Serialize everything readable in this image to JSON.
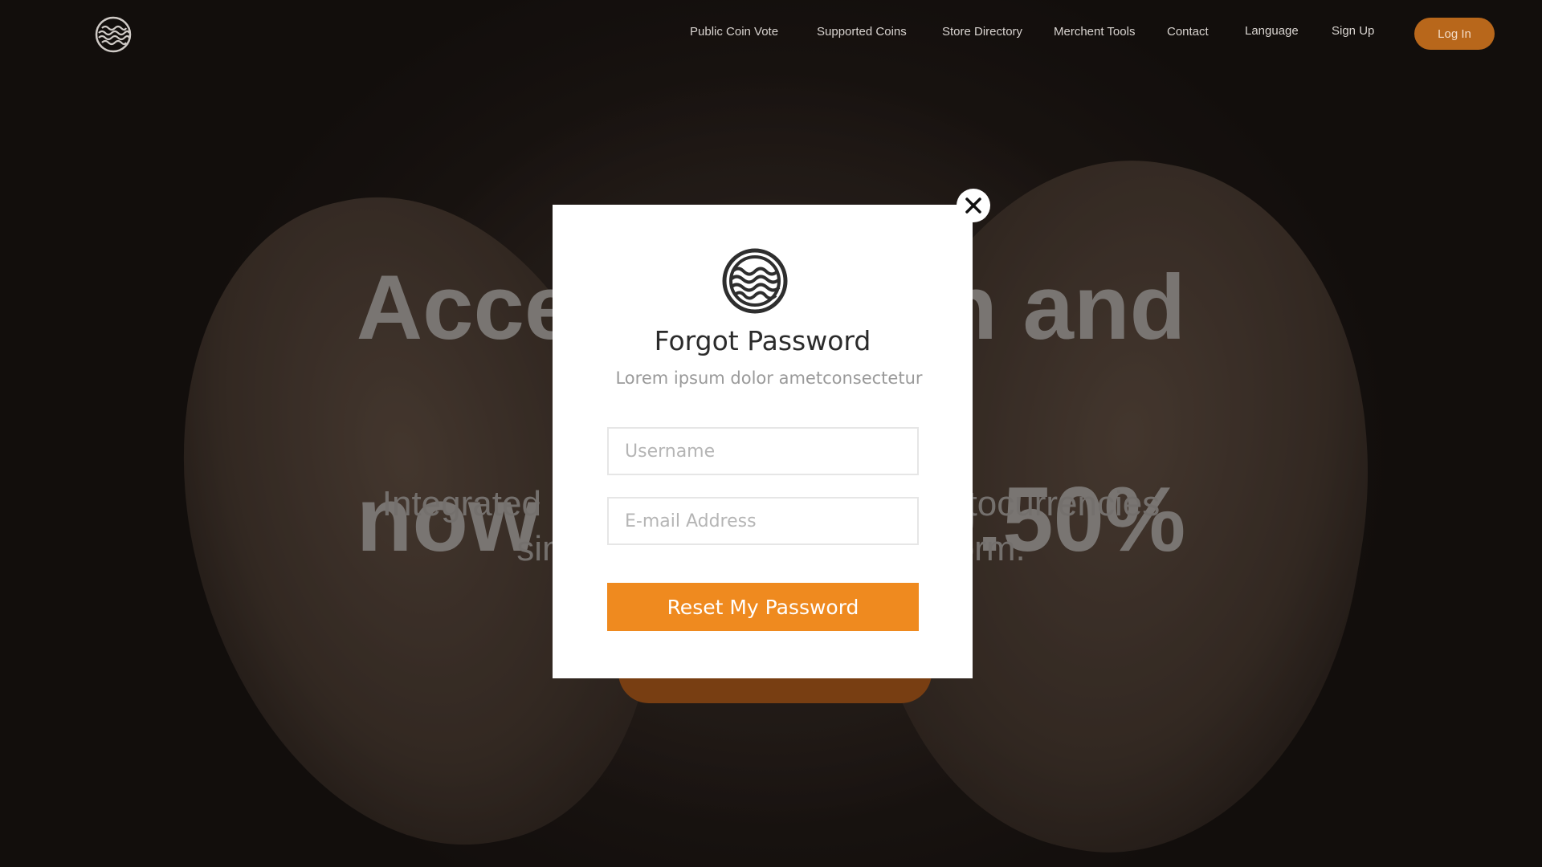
{
  "nav": {
    "items": [
      {
        "label": "Public Coin Vote"
      },
      {
        "label": "Supported Coins"
      },
      {
        "label": "Store Directory"
      },
      {
        "label": "Merchent Tools"
      },
      {
        "label": "Contact"
      },
      {
        "label": "Language"
      },
      {
        "label": "Sign Up"
      }
    ],
    "login_label": "Log In"
  },
  "hero": {
    "title_line1": "Accept Bitcoin and altcoins",
    "title_line2": "now for only 0.50%",
    "subtitle_line1": "Integrated Payment Gateway for cryptocurrencies",
    "subtitle_line2": "simple and easy to use platform."
  },
  "modal": {
    "title": "Forgot Password",
    "subtitle": "Lorem ipsum dolor ametconsectetur",
    "username_placeholder": "Username",
    "email_placeholder": "E-mail Address",
    "reset_label": "Reset My Password"
  },
  "colors": {
    "accent": "#ef8a1f",
    "login_button": "#b8671b",
    "modal_bg": "#ffffff"
  },
  "icons": {
    "brand_logo": "wave-circle-logo-icon",
    "close": "close-icon"
  }
}
